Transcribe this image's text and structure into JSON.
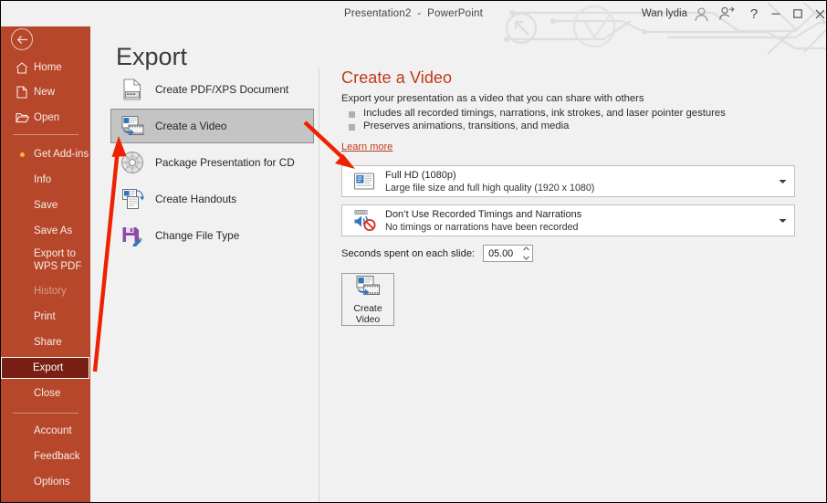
{
  "titlebar": {
    "document_title": "Presentation2  -  PowerPoint",
    "account_name": "Wan lydia",
    "help_glyph": "?",
    "minimize_glyph": "–",
    "maximize_glyph": "□",
    "close_glyph": "✕"
  },
  "sidebar": {
    "back_label": "Back",
    "items": [
      {
        "label": "Home",
        "icon": "home-icon",
        "state": "normal"
      },
      {
        "label": "New",
        "icon": "page-icon",
        "state": "normal"
      },
      {
        "label": "Open",
        "icon": "folder-icon",
        "state": "normal"
      },
      {
        "label": "Get Add-ins",
        "icon": "dot-icon",
        "state": "normal"
      },
      {
        "label": "Info",
        "icon": "none",
        "state": "normal"
      },
      {
        "label": "Save",
        "icon": "none",
        "state": "normal"
      },
      {
        "label": "Save As",
        "icon": "none",
        "state": "normal"
      },
      {
        "label": "Export to WPS PDF",
        "icon": "none",
        "state": "normal"
      },
      {
        "label": "History",
        "icon": "none",
        "state": "disabled"
      },
      {
        "label": "Print",
        "icon": "none",
        "state": "normal"
      },
      {
        "label": "Share",
        "icon": "none",
        "state": "normal"
      },
      {
        "label": "Export",
        "icon": "none",
        "state": "selected"
      },
      {
        "label": "Close",
        "icon": "none",
        "state": "normal"
      },
      {
        "label": "Account",
        "icon": "none",
        "state": "normal"
      },
      {
        "label": "Feedback",
        "icon": "none",
        "state": "normal"
      },
      {
        "label": "Options",
        "icon": "none",
        "state": "normal"
      }
    ]
  },
  "page": {
    "title": "Export"
  },
  "export_options": [
    {
      "label": "Create PDF/XPS Document",
      "icon": "pdf-document-icon",
      "selected": false
    },
    {
      "label": "Create a Video",
      "icon": "video-icon",
      "selected": true
    },
    {
      "label": "Package Presentation for CD",
      "icon": "cd-disc-icon",
      "selected": false
    },
    {
      "label": "Create Handouts",
      "icon": "handouts-icon",
      "selected": false
    },
    {
      "label": "Change File Type",
      "icon": "file-type-icon",
      "selected": false
    }
  ],
  "detail": {
    "title": "Create a Video",
    "subtitle": "Export your presentation as a video that you can share with others",
    "bullets": [
      "Includes all recorded timings, narrations, ink strokes, and laser pointer gestures",
      "Preserves animations, transitions, and media"
    ],
    "learn_more": "Learn more",
    "quality_dropdown": {
      "line1": "Full HD (1080p)",
      "line2": "Large file size and full high quality (1920 x  1080)",
      "icon": "video-quality-icon"
    },
    "timings_dropdown": {
      "line1": "Don’t Use Recorded Timings and Narrations",
      "line2": "No timings or narrations have been recorded",
      "icon": "narration-muted-icon"
    },
    "seconds": {
      "label": "Seconds spent on each slide:",
      "value": "05.00"
    },
    "create_button": {
      "line1": "Create",
      "line2": "Video",
      "icon": "video-icon"
    }
  },
  "colors": {
    "sidebar_bg": "#b7472a",
    "sidebar_selected_bg": "#7a1f14",
    "accent_red": "#c0391b",
    "panel_bg": "#f1f1f1",
    "annotation_red": "#ee2200",
    "selected_item_bg": "#c4c4c4"
  }
}
